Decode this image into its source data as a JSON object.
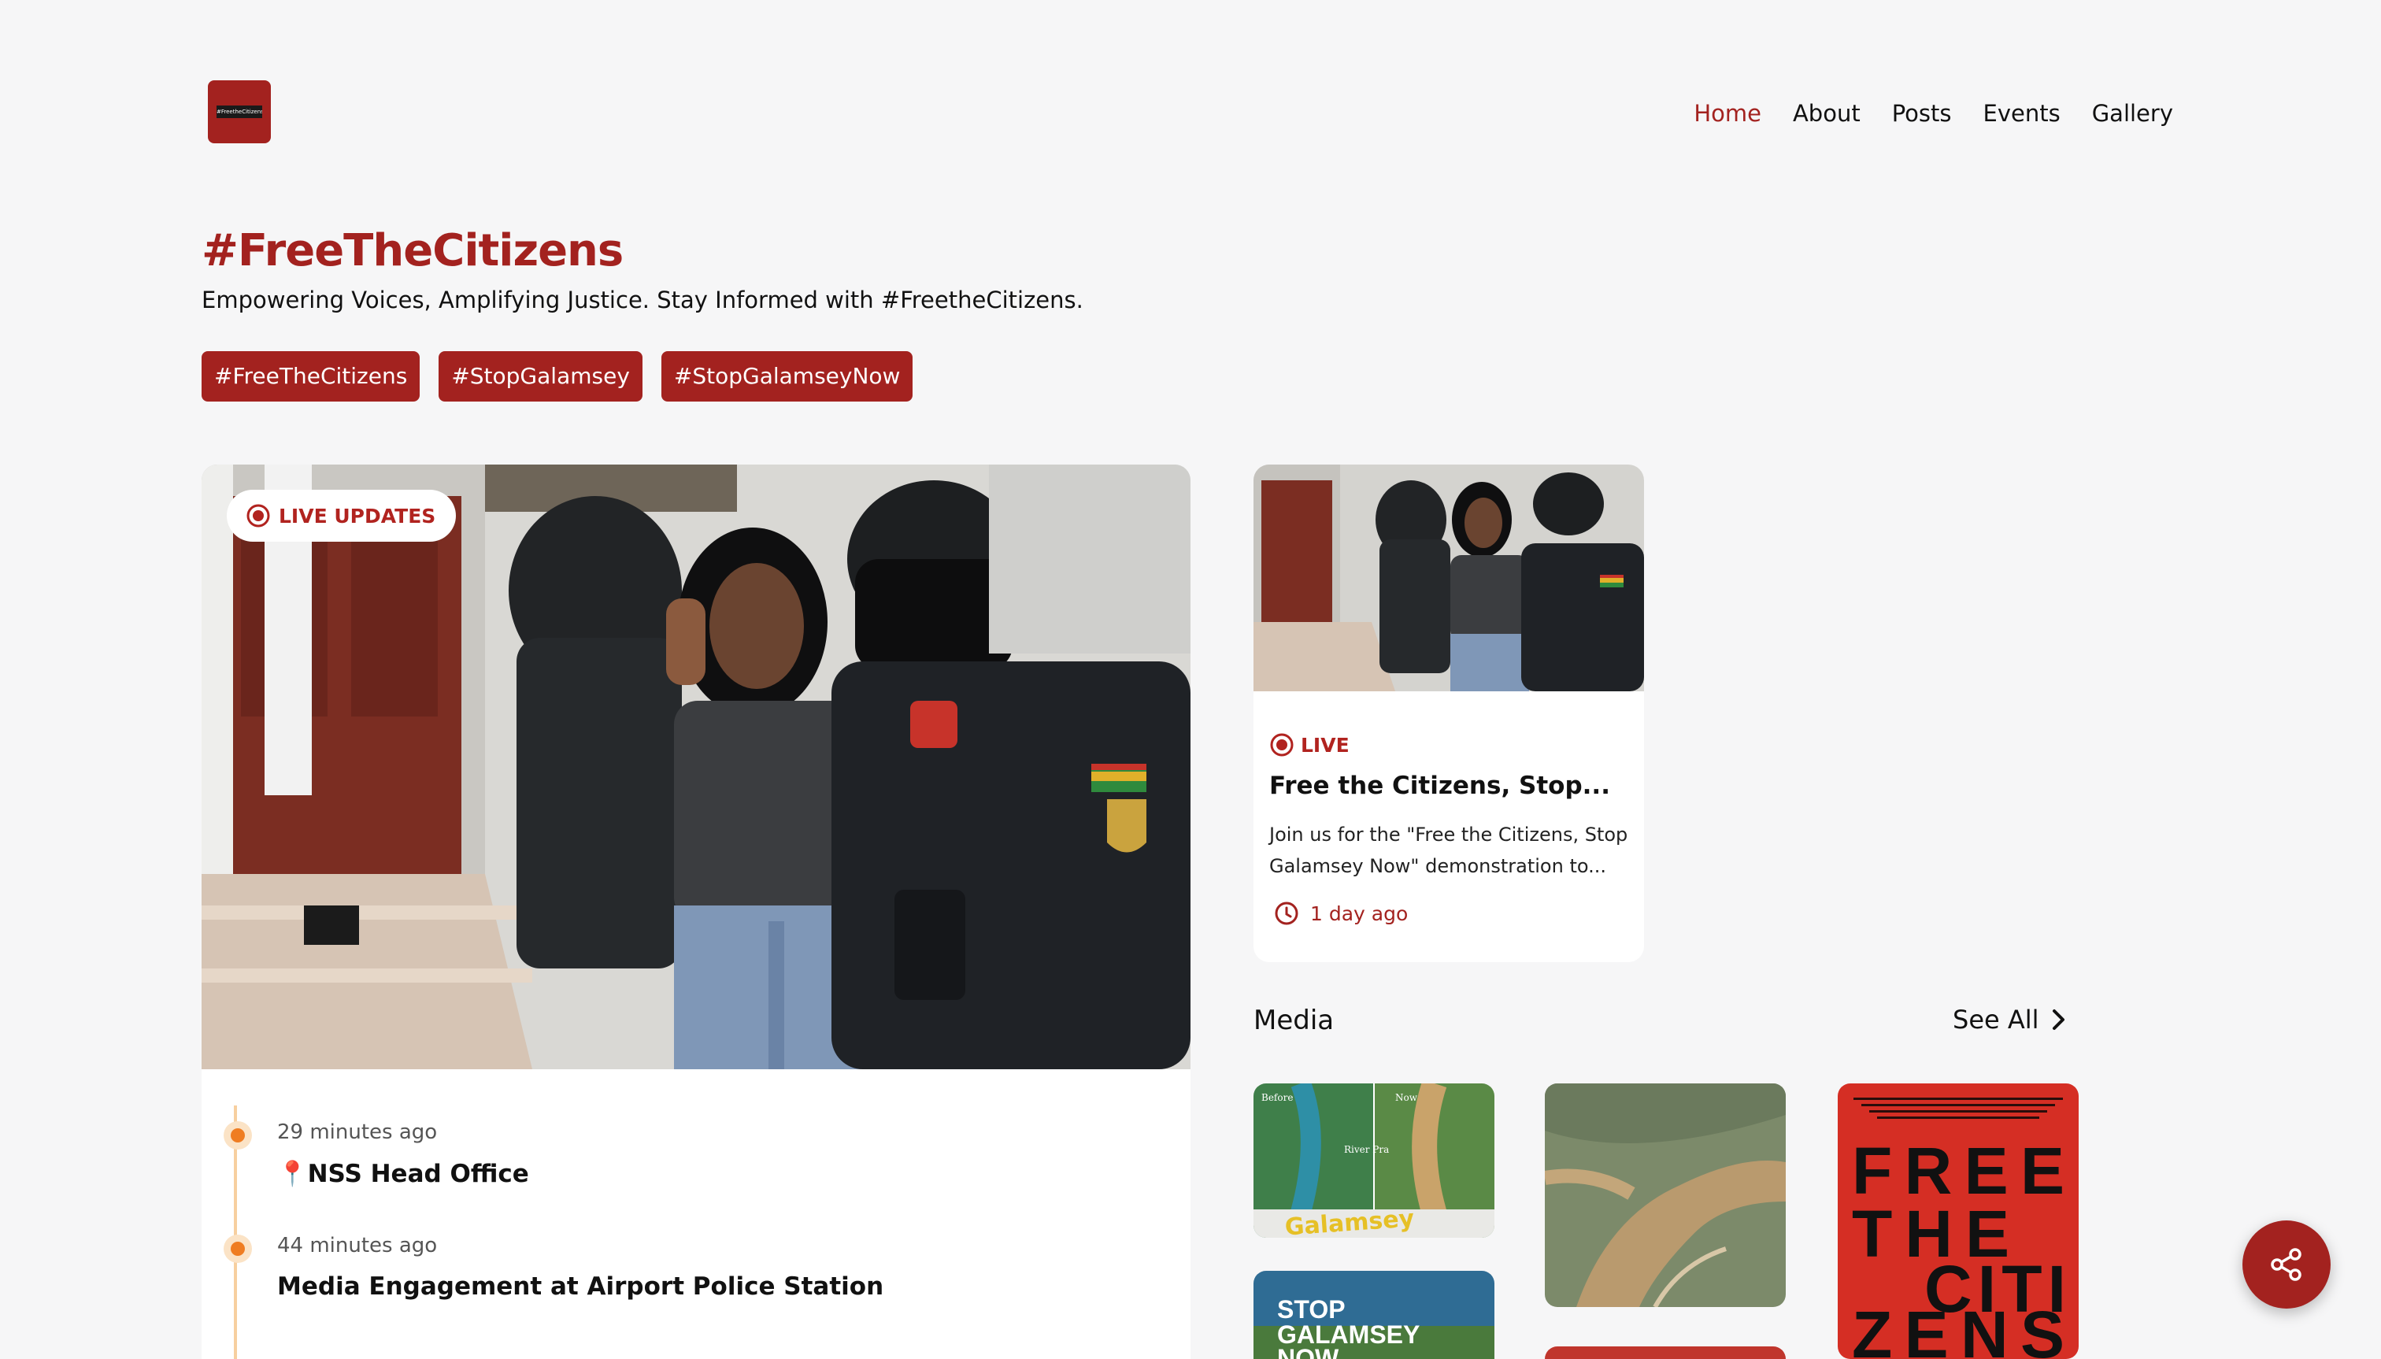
{
  "header": {
    "logo_text": "#FreetheCitizens",
    "nav": [
      {
        "label": "Home",
        "active": true
      },
      {
        "label": "About",
        "active": false
      },
      {
        "label": "Posts",
        "active": false
      },
      {
        "label": "Events",
        "active": false
      },
      {
        "label": "Gallery",
        "active": false
      }
    ]
  },
  "intro": {
    "title": "#FreeTheCitizens",
    "tagline": "Empowering Voices, Amplifying Justice. Stay Informed with #FreetheCitizens.",
    "tags": [
      "#FreeTheCitizens",
      "#StopGalamsey",
      "#StopGalamseyNow"
    ]
  },
  "hero": {
    "badge": "LIVE UPDATES",
    "timeline": [
      {
        "time": "29 minutes ago",
        "title": "📍NSS Head Office"
      },
      {
        "time": "44 minutes ago",
        "title": "Media Engagement at Airport Police Station"
      }
    ]
  },
  "event_card": {
    "badge": "LIVE",
    "title": "Free the Citizens, Stop...",
    "description": "Join us for the \"Free the Citizens, Stop Galamsey Now\" demonstration to...",
    "time": "1 day ago"
  },
  "media": {
    "heading": "Media",
    "see_all": "See All",
    "thumbs": [
      {
        "caption_before": "Before",
        "caption_now": "Now",
        "river": "River Pra",
        "overlay": "Galamsey"
      },
      {
        "overlay": ""
      },
      {
        "overlay": "FREE THE CITI ZENS"
      },
      {
        "overlay": "STOP GALAMSEY NOW"
      }
    ]
  },
  "colors": {
    "brand": "#a3221f",
    "timeline_dot": "#ef7d22",
    "background": "#f6f6f7"
  },
  "icons": {
    "live": "record-icon",
    "time": "clock-icon",
    "see_all": "chevron-right-icon",
    "share": "share-icon"
  }
}
